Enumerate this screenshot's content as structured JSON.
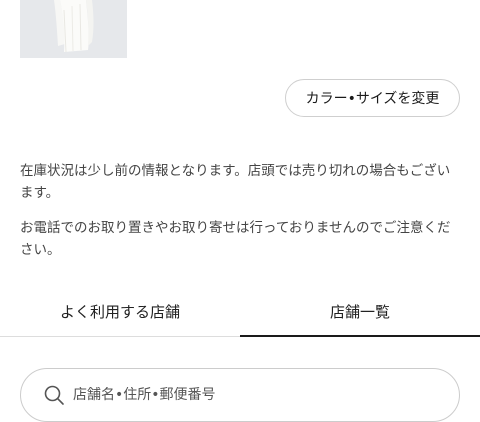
{
  "product": {
    "change_button_label": "カラー•サイズを変更"
  },
  "notices": [
    "在庫状況は少し前の情報となります。店頭では売り切れの場合もございます。",
    "お電話でのお取り置きやお取り寄せは行っておりませんのでご注意ください。"
  ],
  "tabs": [
    {
      "label": "よく利用する店舗",
      "active": false
    },
    {
      "label": "店舗一覧",
      "active": true
    }
  ],
  "search": {
    "placeholder": "店舗名•住所•郵便番号",
    "value": "",
    "icon": "search-icon"
  },
  "colors": {
    "thumbnail_bg": "#e6e8eb",
    "active_tab_underline": "#1a1a1a"
  }
}
